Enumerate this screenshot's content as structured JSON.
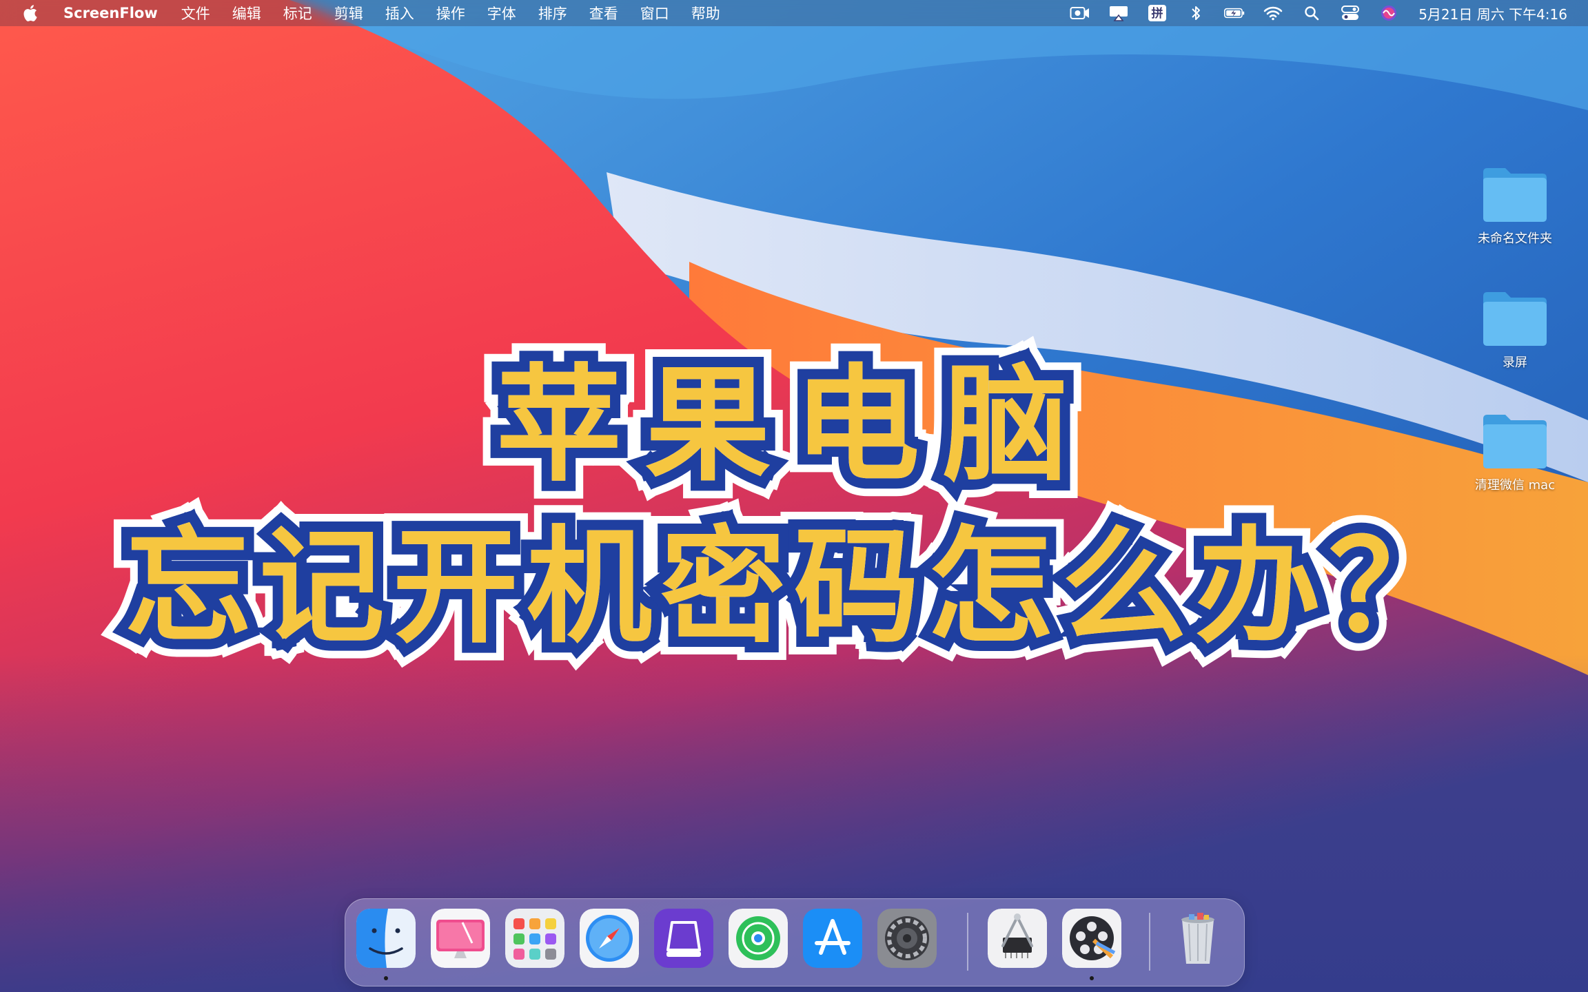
{
  "menubar": {
    "app_name": "ScreenFlow",
    "menus": [
      "文件",
      "编辑",
      "标记",
      "剪辑",
      "插入",
      "操作",
      "字体",
      "排序",
      "查看",
      "窗口",
      "帮助"
    ],
    "status_icons": [
      "screen-record-icon",
      "airplay-icon",
      "input-method-icon",
      "bluetooth-icon",
      "battery-icon",
      "wifi-icon",
      "spotlight-search-icon",
      "control-center-icon",
      "siri-icon"
    ],
    "input_method_label": "拼",
    "clock": "5月21日 周六 下午4:16"
  },
  "desktop": {
    "items": [
      {
        "label": "未命名文件夹",
        "icon": "folder-icon"
      },
      {
        "label": "录屏",
        "icon": "folder-icon"
      },
      {
        "label": "清理微信 mac",
        "icon": "folder-icon"
      }
    ]
  },
  "headline": {
    "line1": "苹果电脑",
    "line2": "忘记开机密码怎么办？"
  },
  "dock": {
    "apps": [
      "finder-icon",
      "cleanmymac-icon",
      "launchpad-icon",
      "safari-icon",
      "ssd-utility-icon",
      "find-my-icon",
      "app-store-icon",
      "system-preferences-icon",
      "system-information-icon",
      "screenflow-icon",
      "trash-icon"
    ]
  },
  "colors": {
    "headline_fill": "#f6c640",
    "headline_stroke": "#1f3fa0",
    "folder_blue": "#5ab4ef"
  }
}
